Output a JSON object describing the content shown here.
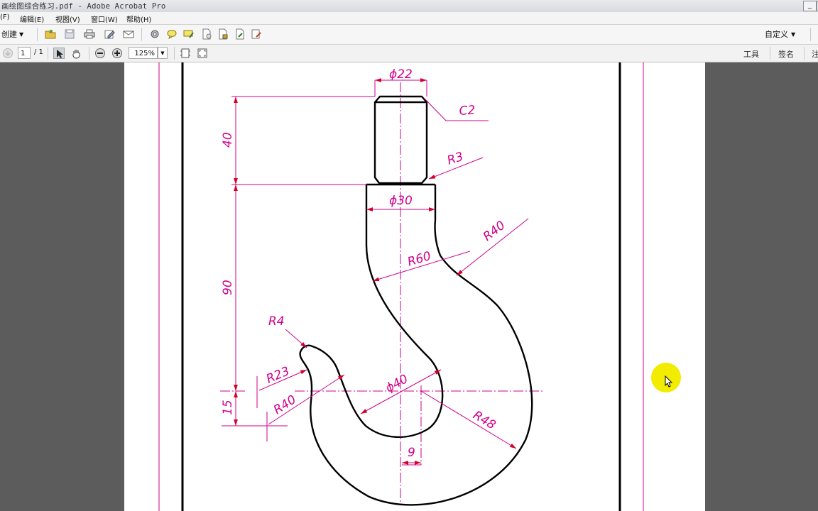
{
  "window": {
    "title": "画绘图综合练习.pdf - Adobe Acrobat Pro",
    "minimize": "_",
    "maximize": "□"
  },
  "menu": [
    "(F)",
    "编辑(E)",
    "视图(V)",
    "窗口(W)",
    "帮助(H)"
  ],
  "toolbar": {
    "create_label": "创建",
    "customize_label": "自定义",
    "icons": [
      "open-icon",
      "save-icon",
      "print-icon",
      "edit-icon",
      "email-icon",
      "settings-icon",
      "comment-icon",
      "highlight-icon",
      "document-icon",
      "secure-icon",
      "sign-icon",
      "forms-icon"
    ]
  },
  "nav": {
    "page_current": "1",
    "page_total": "/ 1",
    "zoom": "125%",
    "tools_label": "工具",
    "sign_label": "签名",
    "comment_label": "注"
  },
  "colors": {
    "dimension": "#d1008c",
    "arrow": "#d3002a",
    "outline": "#000000",
    "centerline": "#d1008c",
    "highlight": "#f2ec00"
  },
  "drawing": {
    "dims": {
      "phi22": "ϕ22",
      "c2": "C2",
      "r3": "R3",
      "phi30": "ϕ30",
      "r40_top": "R40",
      "r60": "R60",
      "len40": "40",
      "len90": "90",
      "r4": "R4",
      "r23": "R23",
      "r40_left": "R40",
      "phi40": "ϕ40",
      "len15": "15",
      "r48": "R48",
      "len9": "9"
    }
  }
}
